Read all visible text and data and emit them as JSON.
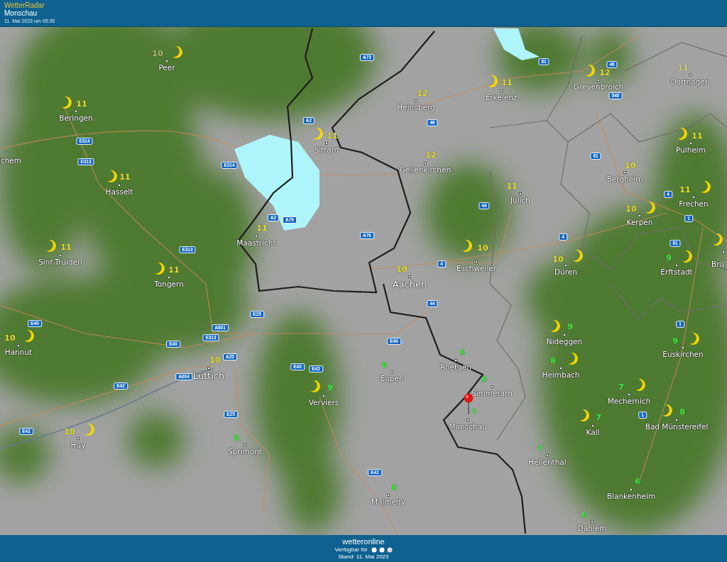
{
  "header": {
    "app_name": "WetterRadar",
    "location": "Monschau",
    "timestamp": "11. Mai 2023 um 05:35"
  },
  "cities": [
    {
      "name": "Peer",
      "kind": "town",
      "temperature": "10",
      "color": "#aebc74",
      "moon": true
    },
    {
      "name": "Grevenbroich",
      "kind": "town",
      "temperature": "12",
      "color": "#e2e030",
      "moon": true
    },
    {
      "name": "Dormagen",
      "kind": "town",
      "temperature": "11",
      "color": "#d4d47a",
      "moon": false
    },
    {
      "name": "Beringen",
      "kind": "town",
      "temperature": "11",
      "color": "#e2e030",
      "moon": true
    },
    {
      "name": "Heinsberg",
      "kind": "town",
      "temperature": "12",
      "color": "#e2e030",
      "moon": false
    },
    {
      "name": "Erkelenz",
      "kind": "town",
      "temperature": "11",
      "color": "#e2e030",
      "moon": true
    },
    {
      "name": "ichem",
      "kind": "town",
      "moon": false
    },
    {
      "name": "Sittard",
      "kind": "town",
      "temperature": "11",
      "color": "#e2e030",
      "moon": true
    },
    {
      "name": "Gellenkirchen",
      "kind": "town",
      "temperature": "12",
      "color": "#e2e030",
      "moon": false
    },
    {
      "name": "Bergheim",
      "kind": "town",
      "temperature": "10",
      "color": "#e2e030",
      "moon": false
    },
    {
      "name": "Pulheim",
      "kind": "town",
      "temperature": "11",
      "color": "#e2e030",
      "moon": true
    },
    {
      "name": "Hasselt",
      "kind": "town",
      "temperature": "11",
      "color": "#e2e030",
      "moon": true
    },
    {
      "name": "Jülich",
      "kind": "town",
      "temperature": "11",
      "color": "#e2e030",
      "moon": false
    },
    {
      "name": "Frechen",
      "kind": "town",
      "temperature": "11",
      "color": "#e2e030",
      "moon": true
    },
    {
      "name": "Kerpen",
      "kind": "town",
      "temperature": "10",
      "color": "#e2e030",
      "moon": true
    },
    {
      "name": "Sint-Truiden",
      "kind": "town",
      "temperature": "11",
      "color": "#e2e030",
      "moon": true
    },
    {
      "name": "Maastricht",
      "kind": "town",
      "temperature": "11",
      "color": "#e2e030",
      "moon": false
    },
    {
      "name": "Eschweiler",
      "kind": "town",
      "temperature": "10",
      "color": "#e2e030",
      "moon": true
    },
    {
      "name": "Düren",
      "kind": "town",
      "temperature": "10",
      "color": "#e2e030",
      "moon": true
    },
    {
      "name": "Erftstadt",
      "kind": "town",
      "temperature": "9",
      "color": "#3cf03c",
      "moon": true
    },
    {
      "name": "Brü",
      "kind": "town",
      "moon": true
    },
    {
      "name": "Tongern",
      "kind": "town",
      "temperature": "11",
      "color": "#e2e030",
      "moon": true
    },
    {
      "name": "Aachen",
      "kind": "city",
      "temperature": "10",
      "color": "#e2e030",
      "moon": false
    },
    {
      "name": "Hannut",
      "kind": "town",
      "temperature": "10",
      "color": "#e2e030",
      "moon": true
    },
    {
      "name": "Nideggen",
      "kind": "town",
      "temperature": "9",
      "color": "#3cf03c",
      "moon": true
    },
    {
      "name": "Euskirchen",
      "kind": "town",
      "temperature": "9",
      "color": "#3cf03c",
      "moon": true
    },
    {
      "name": "Lüttich",
      "kind": "city",
      "temperature": "10",
      "color": "#e2e030",
      "moon": false
    },
    {
      "name": "Eupen",
      "kind": "town",
      "temperature": "8",
      "color": "#3cf03c",
      "moon": false
    },
    {
      "name": "Roetgen",
      "kind": "town",
      "temperature": "6",
      "color": "#3cf03c",
      "moon": false
    },
    {
      "name": "Heimbach",
      "kind": "town",
      "temperature": "8",
      "color": "#3cf03c",
      "moon": true
    },
    {
      "name": "Verviers",
      "kind": "town",
      "temperature": "9",
      "color": "#3cf03c",
      "moon": true
    },
    {
      "name": "Simmerath",
      "kind": "town",
      "temperature": "6",
      "color": "#3cf03c",
      "moon": false
    },
    {
      "name": "Mechernich",
      "kind": "town",
      "temperature": "7",
      "color": "#3cf03c",
      "moon": true
    },
    {
      "name": "Monschau",
      "kind": "town",
      "temperature": "7",
      "color": "#3cf03c",
      "moon": false
    },
    {
      "name": "Kall",
      "kind": "town",
      "temperature": "7",
      "color": "#3cf03c",
      "moon": true
    },
    {
      "name": "Bad Münstereifel",
      "kind": "town",
      "temperature": "8",
      "color": "#3cf03c",
      "moon": true
    },
    {
      "name": "Huy",
      "kind": "town",
      "temperature": "10",
      "color": "#e2e030",
      "moon": true
    },
    {
      "name": "Sprimont",
      "kind": "town",
      "temperature": "8",
      "color": "#3cf03c",
      "moon": false
    },
    {
      "name": "Hellenthal",
      "kind": "town",
      "temperature": "7",
      "color": "#3cf03c",
      "moon": false
    },
    {
      "name": "Malmedy",
      "kind": "town",
      "temperature": "8",
      "color": "#3cf03c",
      "moon": false
    },
    {
      "name": "Blankenheim",
      "kind": "town",
      "temperature": "6",
      "color": "#3cf03c",
      "moon": false
    },
    {
      "name": "Dahlem",
      "kind": "town",
      "temperature": "6",
      "color": "#3cf03c",
      "moon": false
    }
  ],
  "roads": [
    "A73",
    "61",
    "46",
    "540",
    "A2",
    "46",
    "E314",
    "E313",
    "E314",
    "61",
    "4",
    "A2",
    "A79",
    "A76",
    "44",
    "1",
    "4",
    "61",
    "E313",
    "4",
    "E25",
    "A601",
    "E313",
    "E40",
    "A25",
    "E40",
    "E42",
    "A604",
    "E40",
    "E42",
    "E40",
    "44",
    "1",
    "E25",
    "E42",
    "1",
    "E42"
  ],
  "footer": {
    "logo": "wetteronline",
    "availability": "Verfügbar für",
    "updated": "Stand: 11. Mai 2023"
  }
}
